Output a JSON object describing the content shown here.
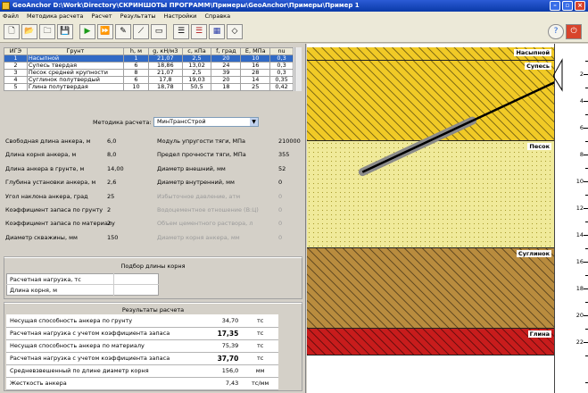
{
  "window": {
    "title": "GeoAnchor D:\\Work\\Directory\\СКРИНШОТЫ ПРОГРАММ\\Примеры\\GeoAnchor\\Примеры\\Пример 1",
    "minimize": "–",
    "close": "×"
  },
  "menu": [
    "Файл",
    "Методика расчета",
    "Расчет",
    "Результаты",
    "Настройки",
    "Справка"
  ],
  "soil_table": {
    "headers": [
      "ИГЭ",
      "Грунт",
      "h, м",
      "g, кН/м3",
      "c, кПа",
      "f, град",
      "E, МПа",
      "nu"
    ],
    "rows": [
      [
        "1",
        "Насыпной",
        "1",
        "21,07",
        "2,5",
        "20",
        "10",
        "0,3"
      ],
      [
        "2",
        "Супесь твердая",
        "6",
        "18,86",
        "13,02",
        "24",
        "16",
        "0,3"
      ],
      [
        "3",
        "Песок средней крупности",
        "8",
        "21,07",
        "2,5",
        "39",
        "28",
        "0,3"
      ],
      [
        "4",
        "Суглинок полутвердый",
        "6",
        "17,8",
        "19,03",
        "20",
        "14",
        "0,35"
      ],
      [
        "5",
        "Глина полутвердая",
        "10",
        "18,78",
        "50,5",
        "18",
        "25",
        "0,42"
      ]
    ]
  },
  "method": {
    "label": "Методика расчета:",
    "value": "МинТрансСтрой"
  },
  "params_left": [
    {
      "label": "Свободная длина анкера, м",
      "value": "6,0"
    },
    {
      "label": "Длина корня анкера, м",
      "value": "8,0"
    },
    {
      "label": "Длина анкера в грунте, м",
      "value": "14,00"
    },
    {
      "label": "Глубина установки анкера, м",
      "value": "2,6"
    },
    {
      "label": "Угол наклона анкера, град",
      "value": "25"
    },
    {
      "label": "Коэффициент запаса по грунту",
      "value": "2"
    },
    {
      "label": "Коэффициент запаса по материалу",
      "value": "2"
    },
    {
      "label": "Диаметр скважины, мм",
      "value": "150"
    }
  ],
  "params_right": [
    {
      "label": "Модуль упругости тяги, МПа",
      "value": "210000",
      "disabled": false
    },
    {
      "label": "Предел прочности тяги, МПа",
      "value": "355",
      "disabled": false
    },
    {
      "label": "Диаметр внешний, мм",
      "value": "52",
      "disabled": false
    },
    {
      "label": "Диаметр внутренний, мм",
      "value": "0",
      "disabled": false
    },
    {
      "label": "Избыточное давление, атм",
      "value": "0",
      "disabled": true
    },
    {
      "label": "Водоцементное отношение (В:Ц)",
      "value": "0",
      "disabled": true
    },
    {
      "label": "Объем цементного раствора, л",
      "value": "0",
      "disabled": true
    },
    {
      "label": "Диаметр корня анкера, мм",
      "value": "0",
      "disabled": true
    }
  ],
  "root_selection": {
    "title": "Подбор длины корня",
    "rows": [
      {
        "label": "Расчетная нагрузка, тс",
        "value": ""
      },
      {
        "label": "Длина корня, м",
        "value": ""
      }
    ]
  },
  "results": {
    "title": "Результаты расчета",
    "rows": [
      {
        "label": "Несущая способность анкера по грунту",
        "value": "34,70",
        "unit": "тс",
        "bold": false
      },
      {
        "label": "Расчетная нагрузка с учетом коэффициента запаса",
        "value": "17,35",
        "unit": "тс",
        "bold": true
      },
      {
        "label": "Несущая способность анкера по материалу",
        "value": "75,39",
        "unit": "тс",
        "bold": false
      },
      {
        "label": "Расчетная нагрузка с учетом коэффициента запаса",
        "value": "37,70",
        "unit": "тс",
        "bold": true
      },
      {
        "label": "Средневзвешенный по длине диаметр корня",
        "value": "156,0",
        "unit": "мм",
        "bold": false
      },
      {
        "label": "Жесткость анкера",
        "value": "7,43",
        "unit": "тс/мм",
        "bold": false
      }
    ]
  },
  "layers": [
    {
      "name": "Насыпной",
      "thickness": 1,
      "color": "#f1ca26"
    },
    {
      "name": "Супесь",
      "thickness": 6,
      "color": "#f1ca26"
    },
    {
      "name": "Песок",
      "thickness": 8,
      "color": "#f0ea9a"
    },
    {
      "name": "Суглинок",
      "thickness": 6,
      "color": "#b98c3e"
    },
    {
      "name": "Глина",
      "thickness": 2,
      "color": "#c81c1c"
    }
  ],
  "anchor": {
    "depth_m": 2.6,
    "angle_deg": 25,
    "free_length_m": 6,
    "root_length_m": 8
  },
  "ruler": {
    "ticks": [
      "2",
      "4",
      "6",
      "8",
      "10",
      "12",
      "14",
      "16",
      "18",
      "20",
      "22"
    ]
  }
}
